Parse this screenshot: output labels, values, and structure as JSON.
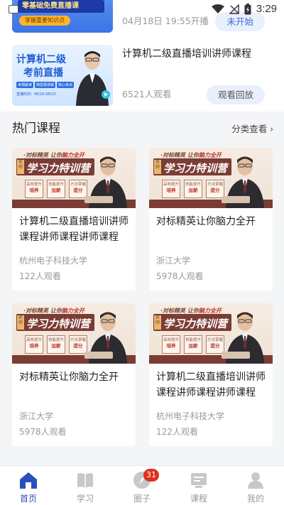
{
  "status_bar": {
    "time": "3:29"
  },
  "live_items": [
    {
      "title": "",
      "meta": "04月18日 19:55开播",
      "button": "未开始",
      "thumb_banner": "零基础免费直播课",
      "thumb_sub": "掌握重要知识点"
    },
    {
      "title": "计算机二级直播培训讲师课程",
      "meta": "6521人观看",
      "button": "观看回放",
      "thumb_line1": "计算机二级",
      "thumb_line2": "考前直播",
      "thumb_chips": [
        "考纲解读",
        "典型题讲解",
        "核心考点"
      ],
      "thumb_time": "直播时间：06/20-06/23"
    }
  ],
  "section": {
    "title": "热门课程",
    "more": "分类查看"
  },
  "cover": {
    "top_prefix": "·对标精英 让你",
    "top_highlight": "脑力全开",
    "main": "学习力特训营",
    "tag": "名师",
    "boxes": [
      {
        "top": "高效提升",
        "bold": "培养"
      },
      {
        "top": "技能提升",
        "bold": "加薪"
      },
      {
        "top": "方法掌握",
        "bold": "提分"
      }
    ]
  },
  "courses": [
    {
      "title": "计算机二级直播培训讲师课程讲师课程讲师课程",
      "school": "杭州电子科技大学",
      "views": "122人观看"
    },
    {
      "title": "对标精英让你脑力全开",
      "school": "浙江大学",
      "views": "5978人观看"
    },
    {
      "title": "对标精英让你脑力全开",
      "school": "浙江大学",
      "views": "5978人观看"
    },
    {
      "title": "计算机二级直播培训讲师课程讲师课程讲师课程",
      "school": "杭州电子科技大学",
      "views": "122人观看"
    }
  ],
  "tabs": [
    {
      "label": "首页",
      "icon": "home-icon",
      "active": true
    },
    {
      "label": "学习",
      "icon": "book-icon"
    },
    {
      "label": "圈子",
      "icon": "compass-icon",
      "badge": "31"
    },
    {
      "label": "课程",
      "icon": "course-icon"
    },
    {
      "label": "我的",
      "icon": "profile-icon"
    }
  ],
  "colors": {
    "accent": "#2c4fbf",
    "badge": "#e0301e",
    "button_bg": "#e9effb",
    "button_text": "#3c6fd8"
  }
}
